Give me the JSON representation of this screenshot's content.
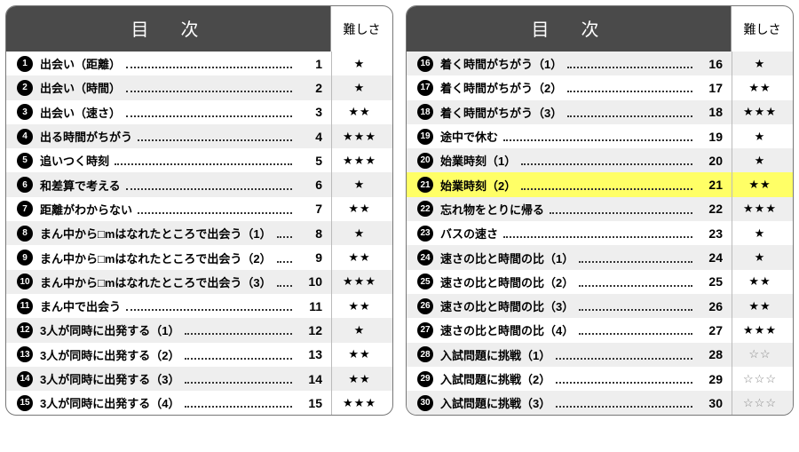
{
  "header": {
    "title": "目　次",
    "difficulty": "難しさ"
  },
  "stars": {
    "filled": "★",
    "open": "☆"
  },
  "panels": [
    {
      "rows": [
        {
          "n": 1,
          "title": "出会い（距離）",
          "page": "1",
          "stars": 1,
          "open": false,
          "alt": false
        },
        {
          "n": 2,
          "title": "出会い（時間）",
          "page": "2",
          "stars": 1,
          "open": false,
          "alt": true
        },
        {
          "n": 3,
          "title": "出会い（速さ）",
          "page": "3",
          "stars": 2,
          "open": false,
          "alt": false
        },
        {
          "n": 4,
          "title": "出る時間がちがう",
          "page": "4",
          "stars": 3,
          "open": false,
          "alt": true
        },
        {
          "n": 5,
          "title": "追いつく時刻",
          "page": "5",
          "stars": 3,
          "open": false,
          "alt": false
        },
        {
          "n": 6,
          "title": "和差算で考える",
          "page": "6",
          "stars": 1,
          "open": false,
          "alt": true
        },
        {
          "n": 7,
          "title": "距離がわからない",
          "page": "7",
          "stars": 2,
          "open": false,
          "alt": false
        },
        {
          "n": 8,
          "title": "まん中から□mはなれたところで出会う（1）",
          "page": "8",
          "stars": 1,
          "open": false,
          "alt": true
        },
        {
          "n": 9,
          "title": "まん中から□mはなれたところで出会う（2）",
          "page": "9",
          "stars": 2,
          "open": false,
          "alt": false
        },
        {
          "n": 10,
          "title": "まん中から□mはなれたところで出会う（3）",
          "page": "10",
          "stars": 3,
          "open": false,
          "alt": true
        },
        {
          "n": 11,
          "title": "まん中で出会う",
          "page": "11",
          "stars": 2,
          "open": false,
          "alt": false
        },
        {
          "n": 12,
          "title": "3人が同時に出発する（1）",
          "page": "12",
          "stars": 1,
          "open": false,
          "alt": true
        },
        {
          "n": 13,
          "title": "3人が同時に出発する（2）",
          "page": "13",
          "stars": 2,
          "open": false,
          "alt": false
        },
        {
          "n": 14,
          "title": "3人が同時に出発する（3）",
          "page": "14",
          "stars": 2,
          "open": false,
          "alt": true
        },
        {
          "n": 15,
          "title": "3人が同時に出発する（4）",
          "page": "15",
          "stars": 3,
          "open": false,
          "alt": false
        }
      ]
    },
    {
      "rows": [
        {
          "n": 16,
          "title": "着く時間がちがう（1）",
          "page": "16",
          "stars": 1,
          "open": false,
          "alt": true
        },
        {
          "n": 17,
          "title": "着く時間がちがう（2）",
          "page": "17",
          "stars": 2,
          "open": false,
          "alt": false
        },
        {
          "n": 18,
          "title": "着く時間がちがう（3）",
          "page": "18",
          "stars": 3,
          "open": false,
          "alt": true
        },
        {
          "n": 19,
          "title": "途中で休む",
          "page": "19",
          "stars": 1,
          "open": false,
          "alt": false
        },
        {
          "n": 20,
          "title": "始業時刻（1）",
          "page": "20",
          "stars": 1,
          "open": false,
          "alt": true
        },
        {
          "n": 21,
          "title": "始業時刻（2）",
          "page": "21",
          "stars": 2,
          "open": false,
          "alt": false,
          "highlight": true
        },
        {
          "n": 22,
          "title": "忘れ物をとりに帰る",
          "page": "22",
          "stars": 3,
          "open": false,
          "alt": true
        },
        {
          "n": 23,
          "title": "バスの速さ",
          "page": "23",
          "stars": 1,
          "open": false,
          "alt": false
        },
        {
          "n": 24,
          "title": "速さの比と時間の比（1）",
          "page": "24",
          "stars": 1,
          "open": false,
          "alt": true
        },
        {
          "n": 25,
          "title": "速さの比と時間の比（2）",
          "page": "25",
          "stars": 2,
          "open": false,
          "alt": false
        },
        {
          "n": 26,
          "title": "速さの比と時間の比（3）",
          "page": "26",
          "stars": 2,
          "open": false,
          "alt": true
        },
        {
          "n": 27,
          "title": "速さの比と時間の比（4）",
          "page": "27",
          "stars": 3,
          "open": false,
          "alt": false
        },
        {
          "n": 28,
          "title": "入試問題に挑戦（1）",
          "page": "28",
          "stars": 2,
          "open": true,
          "alt": true
        },
        {
          "n": 29,
          "title": "入試問題に挑戦（2）",
          "page": "29",
          "stars": 3,
          "open": true,
          "alt": false
        },
        {
          "n": 30,
          "title": "入試問題に挑戦（3）",
          "page": "30",
          "stars": 3,
          "open": true,
          "alt": true
        }
      ]
    }
  ]
}
